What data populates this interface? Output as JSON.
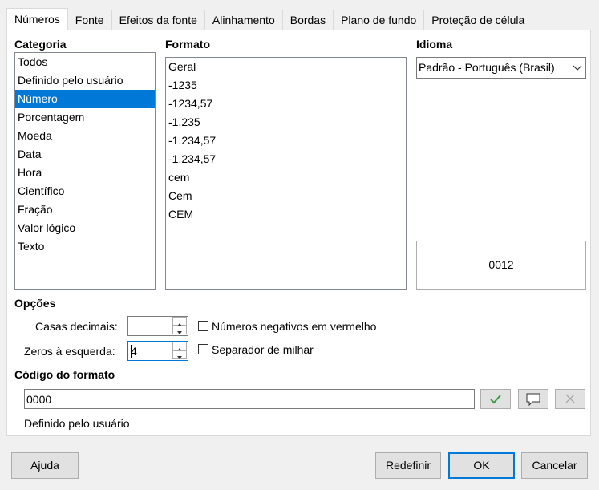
{
  "tabs": [
    "Números",
    "Fonte",
    "Efeitos da fonte",
    "Alinhamento",
    "Bordas",
    "Plano de fundo",
    "Proteção de célula"
  ],
  "categoria": {
    "label": "Categoria",
    "items": [
      "Todos",
      "Definido pelo usuário",
      "Número",
      "Porcentagem",
      "Moeda",
      "Data",
      "Hora",
      "Científico",
      "Fração",
      "Valor lógico",
      "Texto"
    ],
    "selected": "Número"
  },
  "formato": {
    "label": "Formato",
    "items": [
      "Geral",
      "-1235",
      "-1234,57",
      "-1.235",
      "-1.234,57",
      "-1.234,57",
      "cem",
      "Cem",
      "CEM"
    ]
  },
  "idioma": {
    "label": "Idioma",
    "value": "Padrão - Português (Brasil)"
  },
  "preview": {
    "value": "0012"
  },
  "opcoes": {
    "label": "Opções",
    "casas_decimais_label": "Casas decimais:",
    "casas_decimais_value": "",
    "zeros_label": "Zeros à esquerda:",
    "zeros_value": "4",
    "negativos_label": "Números negativos em vermelho",
    "negativos_checked": false,
    "separador_label": "Separador de milhar",
    "separador_checked": false
  },
  "codigo": {
    "label": "Código do formato",
    "value": "0000",
    "description": "Definido pelo usuário"
  },
  "buttons": {
    "ajuda": "Ajuda",
    "redefinir": "Redefinir",
    "ok": "OK",
    "cancelar": "Cancelar"
  },
  "colors": {
    "accent": "#0078d7",
    "confirm_check": "#3a9b45"
  }
}
